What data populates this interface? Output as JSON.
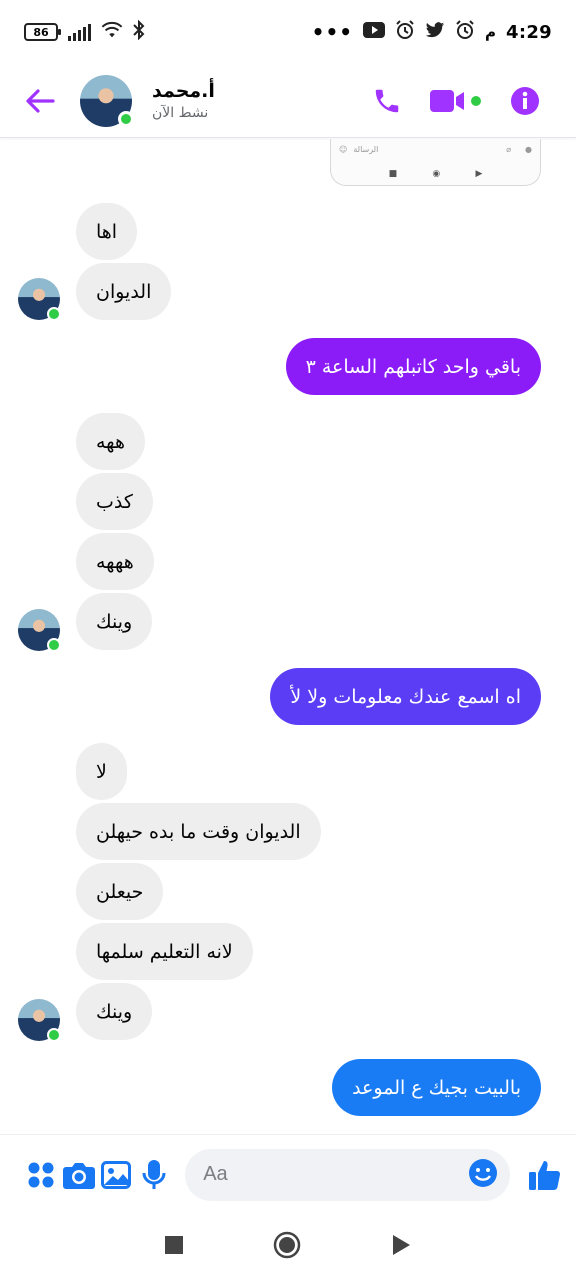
{
  "status_bar": {
    "battery": "86",
    "time": "4:29",
    "ampm": "م",
    "more": "•••"
  },
  "header": {
    "contact_name": "أ.محمد",
    "contact_status": "نشط الآن",
    "accent_color": "#a033ff"
  },
  "preview_card": {
    "placeholder": "الرسالة"
  },
  "messages": [
    {
      "side": "in",
      "text": "اها"
    },
    {
      "side": "in",
      "text": "الديوان"
    },
    {
      "side": "out",
      "text": "باقي واحد كاتبلهم الساعة ٣",
      "color": "#8b1cf8"
    },
    {
      "side": "in",
      "text": "ههه"
    },
    {
      "side": "in",
      "text": "كذب"
    },
    {
      "side": "in",
      "text": "هههه"
    },
    {
      "side": "in",
      "text": "وينك"
    },
    {
      "side": "out",
      "text": "اه اسمع عندك معلومات ولا لأ",
      "color": "#5b3df5"
    },
    {
      "side": "in",
      "text": "لا"
    },
    {
      "side": "in",
      "text": "الديوان وقت ما بده حيهلن"
    },
    {
      "side": "in",
      "text": "حيعلن"
    },
    {
      "side": "in",
      "text": "لانه التعليم سلمها"
    },
    {
      "side": "in",
      "text": "وينك"
    },
    {
      "side": "out",
      "text": "بالبيت بجيك ع الموعد",
      "color": "#1a7cf5"
    }
  ],
  "composer": {
    "placeholder": "Aa",
    "icon_color": "#1877f2"
  }
}
